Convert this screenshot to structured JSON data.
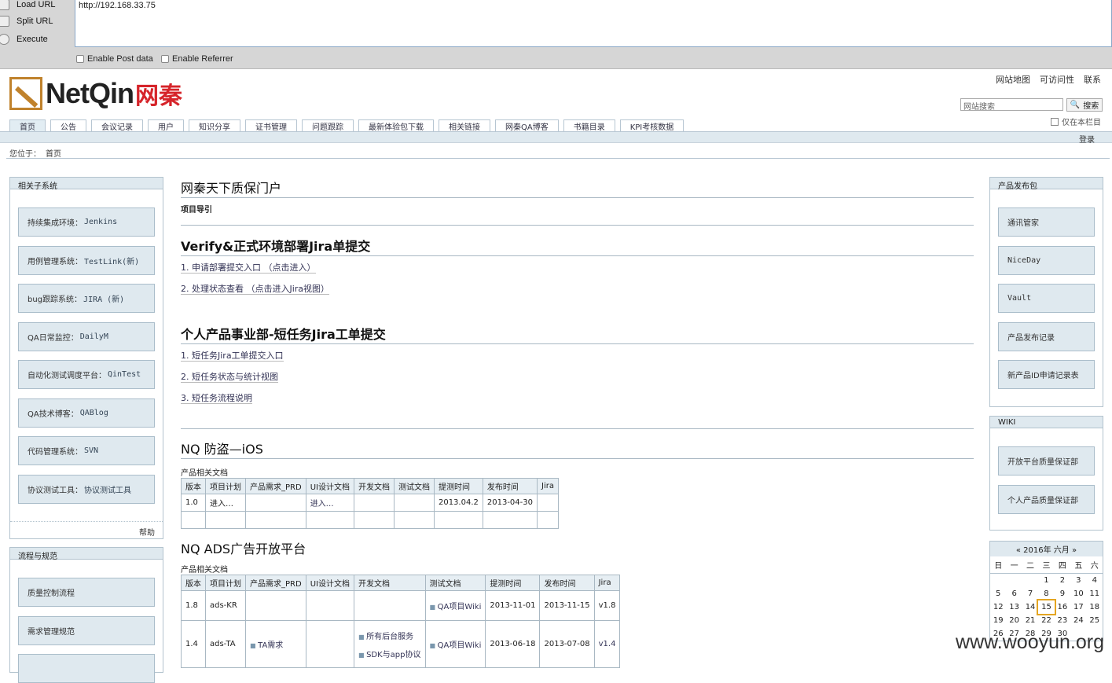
{
  "hackbar": {
    "load": "Load URL",
    "split": "Split URL",
    "execute": "Execute",
    "url": "http://192.168.33.75",
    "post": "Enable Post data",
    "referrer": "Enable Referrer"
  },
  "top": {
    "links": [
      "网站地图",
      "可访问性",
      "联系"
    ],
    "search_placeholder": "网站搜索",
    "search_btn": "搜索",
    "scope": "仅在本栏目"
  },
  "logo": {
    "en": "NetQin",
    "cn": "网秦"
  },
  "nav": [
    "首页",
    "公告",
    "会议记录",
    "用户",
    "知识分享",
    "证书管理",
    "问题跟踪",
    "最新体验包下载",
    "相关链接",
    "网秦QA博客",
    "书籍目录",
    "KPI考核数据"
  ],
  "login": "登录",
  "crumb": {
    "label": "您位于：",
    "home": "首页"
  },
  "left": {
    "title": "相关子系统",
    "items": [
      [
        "持续集成环境：",
        "Jenkins"
      ],
      [
        "用例管理系统：",
        "TestLink(新)"
      ],
      [
        "bug跟踪系统：",
        "JIRA (新)"
      ],
      [
        "QA日常监控：",
        "DailyM"
      ],
      [
        "自动化测试调度平台：",
        "QinTest"
      ],
      [
        "QA技术博客：",
        "QABlog"
      ],
      [
        "代码管理系统：",
        "SVN"
      ],
      [
        "协议测试工具：",
        "协议测试工具"
      ]
    ],
    "help": "帮助",
    "title2": "流程与规范",
    "items2": [
      "质量控制流程",
      "需求管理规范"
    ]
  },
  "right": {
    "title": "产品发布包",
    "items": [
      "通讯管家",
      "NiceDay",
      "Vault",
      "产品发布记录",
      "新产品ID申请记录表"
    ],
    "wiki_title": "WIKI",
    "wiki": [
      "开放平台质量保证部",
      "个人产品质量保证部"
    ]
  },
  "calendar": {
    "header": "« 2016年 六月 »",
    "days": [
      "日",
      "一",
      "二",
      "三",
      "四",
      "五",
      "六"
    ],
    "weeks": [
      [
        "",
        "",
        "",
        "1",
        "2",
        "3",
        "4"
      ],
      [
        "5",
        "6",
        "7",
        "8",
        "9",
        "10",
        "11"
      ],
      [
        "12",
        "13",
        "14",
        "15",
        "16",
        "17",
        "18"
      ],
      [
        "19",
        "20",
        "21",
        "22",
        "23",
        "24",
        "25"
      ],
      [
        "26",
        "27",
        "28",
        "29",
        "30",
        "",
        ""
      ]
    ],
    "today": "15"
  },
  "main": {
    "portal": "网秦天下质保门户",
    "nav_label": "项目导引",
    "sec1": {
      "title": "Verify&正式环境部署Jira单提交",
      "links": [
        "1. 申请部署提交入口 （点击进入）",
        "2. 处理状态查看 （点击进入Jira视图）"
      ]
    },
    "sec2": {
      "title": "个人产品事业部-短任务Jira工单提交",
      "links": [
        "1. 短任务Jira工单提交入口",
        "2. 短任务状态与统计视图",
        "3. 短任务流程说明"
      ]
    },
    "sec3": {
      "title": "NQ 防盗—iOS",
      "doc": "产品相关文档",
      "headers": [
        "版本",
        "项目计划",
        "产品需求_PRD",
        "UI设计文档",
        "开发文档",
        "测试文档",
        "提测时间",
        "发布时间",
        "Jira"
      ],
      "rows": [
        [
          "1.0",
          "进入…",
          "",
          "进入…",
          "",
          "",
          "2013.04.2",
          "2013-04-30",
          ""
        ],
        [
          "",
          "",
          "",
          "",
          "",
          "",
          "",
          "",
          ""
        ]
      ]
    },
    "sec4": {
      "title": "NQ ADS广告开放平台",
      "doc": "产品相关文档",
      "headers": [
        "版本",
        "项目计划",
        "产品需求_PRD",
        "UI设计文档",
        "开发文档",
        "测试文档",
        "提测时间",
        "发布时间",
        "Jira"
      ],
      "rows": [
        [
          "1.8",
          "ads-KR",
          "",
          "",
          "",
          "QA项目Wiki",
          "2013-11-01",
          "2013-11-15",
          "v1.8"
        ],
        [
          "1.4",
          "ads-TA",
          "TA需求",
          "",
          "所有后台服务|SDK与app协议",
          "QA项目Wiki",
          "2013-06-18",
          "2013-07-08",
          "v1.4"
        ]
      ]
    }
  },
  "watermark": "www.wooyun.org"
}
